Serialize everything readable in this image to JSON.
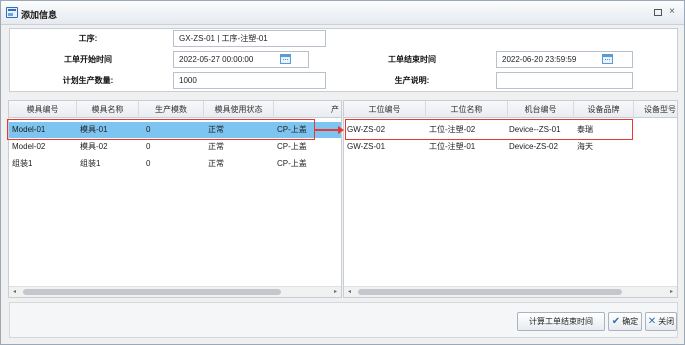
{
  "window": {
    "title": "添加信息",
    "close_symbol": "×"
  },
  "form": {
    "process_label": "工序:",
    "process_value": "GX-ZS-01 | 工序-注塑-01",
    "start_time_label": "工单开始时间",
    "start_time_value": "2022-05-27 00:00:00",
    "end_time_label": "工单结束时间",
    "end_time_value": "2022-06-20 23:59:59",
    "planned_qty_label": "计划生产数量:",
    "planned_qty_value": "1000",
    "remark_label": "生产说明:",
    "remark_value": ""
  },
  "mold_table": {
    "columns": [
      "模具编号",
      "模具名称",
      "生产模数",
      "模具使用状态",
      "产"
    ],
    "rows": [
      [
        "Model-01",
        "模具-01",
        "0",
        "正常",
        "CP-上盖"
      ],
      [
        "Model-02",
        "模具-02",
        "0",
        "正常",
        "CP-上盖"
      ],
      [
        "组装1",
        "组装1",
        "0",
        "正常",
        "CP-上盖"
      ]
    ],
    "scroll_left": "◂",
    "scroll_right": "▸"
  },
  "station_table": {
    "columns": [
      "工位编号",
      "工位名称",
      "机台编号",
      "设备品牌",
      "设备型号"
    ],
    "rows": [
      [
        "GW-ZS-02",
        "工位-注塑-02",
        "Device--ZS-01",
        "泰瑞",
        ""
      ],
      [
        "GW-ZS-01",
        "工位-注塑-01",
        "Device-ZS-02",
        "海天",
        ""
      ]
    ],
    "scroll_left": "◂",
    "scroll_right": "▸"
  },
  "buttons": {
    "calc_end_time": "计算工单结束时间",
    "confirm": "确定",
    "close": "关闭",
    "confirm_icon": "✔",
    "close_icon": "✕"
  },
  "colors": {
    "selected_row": "#7dc4f0",
    "highlight": "#e53935",
    "accent": "#2f6fb5"
  },
  "icons": [
    "window-icon",
    "maximize-icon",
    "close-icon",
    "calendar-icon",
    "check-icon",
    "x-icon"
  ]
}
